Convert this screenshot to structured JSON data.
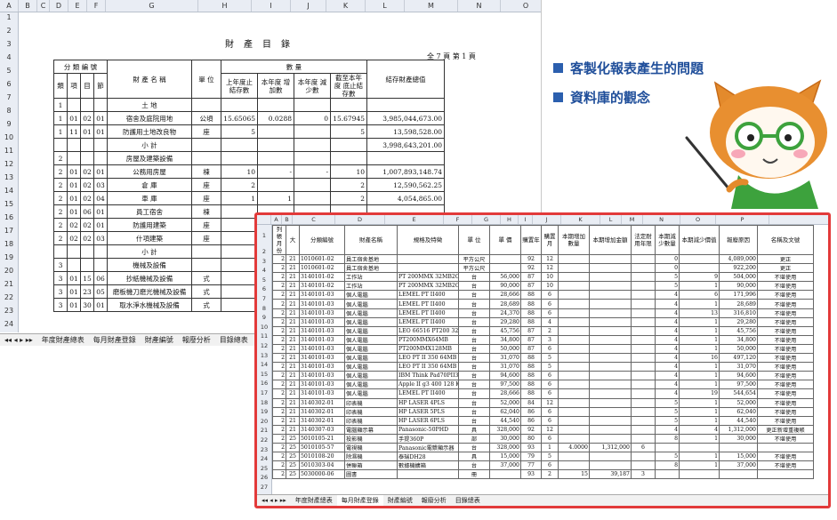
{
  "bullets": [
    "客製化報表產生的問題",
    "資料庫的觀念"
  ],
  "sheet1": {
    "col_headers": [
      "A",
      "B",
      "C",
      "D",
      "E",
      "F",
      "G",
      "H",
      "I",
      "J",
      "K",
      "L",
      "M",
      "N",
      "O"
    ],
    "row_numbers": [
      "1",
      "2",
      "3",
      "4",
      "5",
      "6",
      "7",
      "8",
      "9",
      "10",
      "11",
      "12",
      "13",
      "14",
      "15",
      "16",
      "17",
      "18",
      "19",
      "20",
      "21",
      "22",
      "23",
      "24"
    ],
    "title": "財產目錄",
    "page_info": "全 7 頁   第 1 頁",
    "header": {
      "classification": "分 類 編 號",
      "lei": "類",
      "xiang": "項",
      "mu": "目",
      "jie": "節",
      "name": "財 產 名 稱",
      "unit": "單 位",
      "quantity": "數          量",
      "prev_qty": "上年度止 結存數",
      "increase": "本年度 增加數",
      "decrease": "本年度 減少數",
      "current": "截至本年度 底止結存數",
      "total_value": "結存財產總值"
    },
    "rows": [
      {
        "a": "1",
        "b": "",
        "c": "",
        "d": "",
        "name": "土 地",
        "unit": "",
        "prev": "",
        "inc": "",
        "dec": "",
        "cur": "",
        "val": ""
      },
      {
        "a": "1",
        "b": "01",
        "c": "02",
        "d": "01",
        "name": "宿舍及庭院用地",
        "unit": "公頃",
        "prev": "15.65065",
        "inc": "0.0288",
        "dec": "0",
        "cur": "15.67945",
        "val": "3,985,044,673.00"
      },
      {
        "a": "1",
        "b": "11",
        "c": "01",
        "d": "01",
        "name": "防護用土地改良物",
        "unit": "座",
        "prev": "5",
        "inc": "",
        "dec": "",
        "cur": "5",
        "val": "13,598,528.00"
      },
      {
        "a": "",
        "b": "",
        "c": "",
        "d": "",
        "name": "小 計",
        "unit": "",
        "prev": "",
        "inc": "",
        "dec": "",
        "cur": "",
        "val": "3,998,643,201.00"
      },
      {
        "a": "2",
        "b": "",
        "c": "",
        "d": "",
        "name": "房屋及建築設備",
        "unit": "",
        "prev": "",
        "inc": "",
        "dec": "",
        "cur": "",
        "val": ""
      },
      {
        "a": "2",
        "b": "01",
        "c": "02",
        "d": "01",
        "name": "公務用房屋",
        "unit": "棟",
        "prev": "10",
        "inc": "-",
        "dec": "-",
        "cur": "10",
        "val": "1,007,893,148.74"
      },
      {
        "a": "2",
        "b": "01",
        "c": "02",
        "d": "03",
        "name": "倉 庫",
        "unit": "座",
        "prev": "2",
        "inc": "",
        "dec": "",
        "cur": "2",
        "val": "12,590,562.25"
      },
      {
        "a": "2",
        "b": "01",
        "c": "02",
        "d": "04",
        "name": "車 庫",
        "unit": "座",
        "prev": "1",
        "inc": "1",
        "dec": "",
        "cur": "2",
        "val": "4,054,865.00"
      },
      {
        "a": "2",
        "b": "01",
        "c": "06",
        "d": "01",
        "name": "員工宿舍",
        "unit": "棟",
        "prev": "",
        "inc": "",
        "dec": "",
        "cur": "",
        "val": ""
      },
      {
        "a": "2",
        "b": "02",
        "c": "02",
        "d": "01",
        "name": "防護用建築",
        "unit": "座",
        "prev": "",
        "inc": "",
        "dec": "",
        "cur": "",
        "val": ""
      },
      {
        "a": "2",
        "b": "02",
        "c": "02",
        "d": "03",
        "name": "什項建築",
        "unit": "座",
        "prev": "",
        "inc": "",
        "dec": "",
        "cur": "",
        "val": ""
      },
      {
        "a": "",
        "b": "",
        "c": "",
        "d": "",
        "name": "小 計",
        "unit": "",
        "prev": "",
        "inc": "",
        "dec": "",
        "cur": "",
        "val": ""
      },
      {
        "a": "3",
        "b": "",
        "c": "",
        "d": "",
        "name": "機械及設備",
        "unit": "",
        "prev": "",
        "inc": "",
        "dec": "",
        "cur": "",
        "val": ""
      },
      {
        "a": "3",
        "b": "01",
        "c": "15",
        "d": "06",
        "name": "抄紙機械及設備",
        "unit": "式",
        "prev": "",
        "inc": "",
        "dec": "",
        "cur": "",
        "val": ""
      },
      {
        "a": "3",
        "b": "01",
        "c": "23",
        "d": "05",
        "name": "磨板機刀磨光機械及設備",
        "unit": "式",
        "prev": "",
        "inc": "",
        "dec": "",
        "cur": "",
        "val": ""
      },
      {
        "a": "3",
        "b": "01",
        "c": "30",
        "d": "01",
        "name": "取水淨水機械及設備",
        "unit": "式",
        "prev": "",
        "inc": "",
        "dec": "",
        "cur": "",
        "val": ""
      }
    ],
    "tabs": [
      "年度財產總表",
      "每月財產登錄",
      "財產編號",
      "報廢分析",
      "目錄總表"
    ]
  },
  "sheet2": {
    "col_headers": [
      "A",
      "B",
      "C",
      "D",
      "E",
      "F",
      "G",
      "H",
      "I",
      "J",
      "K",
      "L",
      "M",
      "N",
      "O",
      "P"
    ],
    "row_numbers": [
      "1",
      "2",
      "3",
      "4",
      "5",
      "6",
      "7",
      "8",
      "9",
      "10",
      "11",
      "12",
      "13",
      "14",
      "15",
      "16",
      "17",
      "18",
      "19",
      "20",
      "21",
      "22",
      "23",
      "24",
      "25",
      "26",
      "27"
    ],
    "header": [
      "列帳月份",
      "大",
      "分類編號",
      "財產名稱",
      "規格及特徵",
      "單 位",
      "單 價",
      "購置年",
      "購置月",
      "本期增加數量",
      "本期增加金額",
      "法定耐用年限",
      "本期減少數量",
      "本期減少價值",
      "報廢原因",
      "名稱及文號"
    ],
    "rows": [
      [
        "2",
        "21",
        "1010601-02",
        "員工宿舍基地",
        "",
        "平方公尺",
        "",
        "92",
        "12",
        "",
        "",
        "",
        "0",
        "",
        "4,089,000",
        "更正"
      ],
      [
        "2",
        "21",
        "1010601-02",
        "員工宿舍基地",
        "",
        "平方公尺",
        "",
        "92",
        "12",
        "",
        "",
        "",
        "0",
        "",
        "922,200",
        "更正"
      ],
      [
        "2",
        "21",
        "3140101-02",
        "工作站",
        "PT 200MMX 32MB2GB",
        "台",
        "56,000",
        "87",
        "10",
        "",
        "",
        "",
        "5",
        "9",
        "504,000",
        "不堪使用"
      ],
      [
        "2",
        "21",
        "3140101-02",
        "工作站",
        "PT 200MMX 32MB2GB",
        "台",
        "90,000",
        "87",
        "10",
        "",
        "",
        "",
        "5",
        "1",
        "90,000",
        "不堪使用"
      ],
      [
        "2",
        "21",
        "3140101-03",
        "個人電腦",
        "LEMEL PT II400",
        "台",
        "28,666",
        "88",
        "6",
        "",
        "",
        "",
        "4",
        "6",
        "171,996",
        "不堪使用"
      ],
      [
        "2",
        "21",
        "3140101-03",
        "個人電腦",
        "LEMEL PT II400",
        "台",
        "28,689",
        "88",
        "6",
        "",
        "",
        "",
        "4",
        "1",
        "28,689",
        "不堪使用"
      ],
      [
        "2",
        "21",
        "3140101-03",
        "個人電腦",
        "LEMEL PT II400",
        "台",
        "24,370",
        "88",
        "6",
        "",
        "",
        "",
        "4",
        "13",
        "316,810",
        "不堪使用"
      ],
      [
        "2",
        "21",
        "3140101-03",
        "個人電腦",
        "LEMEL PT II400",
        "台",
        "29,280",
        "88",
        "4",
        "",
        "",
        "",
        "4",
        "1",
        "29,280",
        "不堪使用"
      ],
      [
        "2",
        "21",
        "3140101-03",
        "個人電腦",
        "LEO 66516 PT200 32MB",
        "台",
        "45,756",
        "87",
        "2",
        "",
        "",
        "",
        "4",
        "1",
        "45,756",
        "不堪使用"
      ],
      [
        "2",
        "21",
        "3140101-03",
        "個人電腦",
        "PT200MMX64MB",
        "台",
        "34,800",
        "87",
        "3",
        "",
        "",
        "",
        "4",
        "1",
        "34,800",
        "不堪使用"
      ],
      [
        "2",
        "21",
        "3140101-03",
        "個人電腦",
        "PT200MMX128MB",
        "台",
        "50,000",
        "87",
        "6",
        "",
        "",
        "",
        "4",
        "1",
        "50,000",
        "不堪使用"
      ],
      [
        "2",
        "21",
        "3140101-03",
        "個人電腦",
        "LEO PT II 350 64MB",
        "台",
        "31,070",
        "88",
        "5",
        "",
        "",
        "",
        "4",
        "16",
        "497,120",
        "不堪使用"
      ],
      [
        "2",
        "21",
        "3140101-03",
        "個人電腦",
        "LEO PT II 350 64MB",
        "台",
        "31,070",
        "88",
        "5",
        "",
        "",
        "",
        "4",
        "1",
        "31,070",
        "不堪使用"
      ],
      [
        "2",
        "21",
        "3140101-03",
        "個人電腦",
        "IBM Think Pad70PII300",
        "台",
        "94,600",
        "88",
        "6",
        "",
        "",
        "",
        "4",
        "1",
        "94,600",
        "不堪使用"
      ],
      [
        "2",
        "21",
        "3140101-03",
        "個人電腦",
        "Apple II g3 400 128 KB 9GB",
        "台",
        "97,500",
        "88",
        "6",
        "",
        "",
        "",
        "4",
        "1",
        "97,500",
        "不堪使用"
      ],
      [
        "2",
        "21",
        "3140101-03",
        "個人電腦",
        "LEMEL PT II400",
        "台",
        "28,666",
        "88",
        "6",
        "",
        "",
        "",
        "4",
        "19",
        "544,654",
        "不堪使用"
      ],
      [
        "2",
        "21",
        "3140302-01",
        "印表機",
        "HP LASER 4PLS",
        "台",
        "52,000",
        "84",
        "12",
        "",
        "",
        "",
        "5",
        "1",
        "52,000",
        "不堪使用"
      ],
      [
        "2",
        "21",
        "3140302-01",
        "印表機",
        "HP LASER 5PLS",
        "台",
        "62,040",
        "86",
        "6",
        "",
        "",
        "",
        "5",
        "1",
        "62,040",
        "不堪使用"
      ],
      [
        "2",
        "21",
        "3140302-01",
        "印表機",
        "HP LASER 6PLS",
        "台",
        "44,540",
        "86",
        "6",
        "",
        "",
        "",
        "5",
        "1",
        "44,540",
        "不堪使用"
      ],
      [
        "2",
        "21",
        "3140307-03",
        "電腦顯示幕",
        "Panasonic-50PHD",
        "具",
        "328,000",
        "92",
        "12",
        "",
        "",
        "",
        "4",
        "4",
        "1,312,000",
        "更正新增重複帳"
      ],
      [
        "2",
        "25",
        "5010105-21",
        "投影機",
        "手提360P",
        "部",
        "30,000",
        "80",
        "6",
        "",
        "",
        "",
        "8",
        "1",
        "30,000",
        "不堪使用"
      ],
      [
        "2",
        "25",
        "5010105-57",
        "電視機",
        "Panasonic電漿顯示器",
        "台",
        "328,000",
        "93",
        "1",
        "4.0000",
        "1,312,000",
        "6",
        "",
        "",
        "",
        ""
      ],
      [
        "2",
        "25",
        "5010108-20",
        "除濕機",
        "泰瑞DH28",
        "具",
        "15,000",
        "79",
        "5",
        "",
        "",
        "",
        "5",
        "1",
        "15,000",
        "不堪使用"
      ],
      [
        "2",
        "25",
        "5010303-04",
        "併聯箱",
        "數據機擴箱",
        "台",
        "37,000",
        "77",
        "6",
        "",
        "",
        "",
        "8",
        "1",
        "37,000",
        "不堪使用"
      ],
      [
        "2",
        "25",
        "5030000-06",
        "圖書",
        "",
        "冊",
        "",
        "93",
        "2",
        "15",
        "39,187",
        "3",
        "",
        "",
        "",
        ""
      ]
    ],
    "tabs": [
      "年度財產總表",
      "每月財產登錄",
      "財產編號",
      "報廢分析",
      "目錄總表"
    ]
  },
  "colors": {
    "accent_border": "#e23a3a",
    "bullet_text": "#1f4e9a",
    "mascot_orange": "#e38a2c",
    "glasses_green": "#3da23d"
  }
}
